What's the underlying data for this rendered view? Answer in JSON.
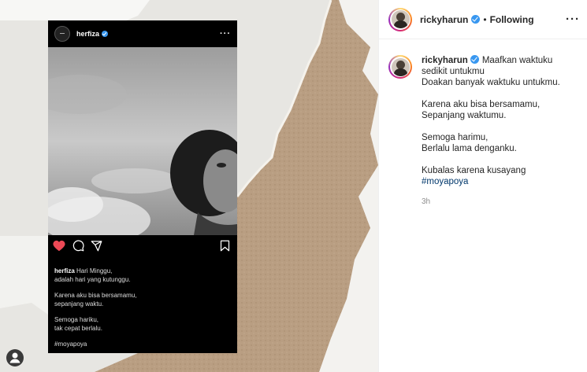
{
  "card": {
    "username": "herfiza",
    "caption_user": "herfiza",
    "caption_lines": [
      "Hari Minggu,\nadalah hari yang kutunggu.",
      "Karena aku bisa bersamamu,\nsepanjang waktu.",
      "Semoga hariku,\ntak cepat berlalu."
    ],
    "hashtag": "#moyapoya",
    "liked": true
  },
  "header": {
    "username": "rickyharun",
    "separator": "•",
    "follow_label": "Following",
    "more_icon": "more-horizontal-icon"
  },
  "comment": {
    "username": "rickyharun",
    "first_line": "Maafkan waktuku",
    "lines": [
      "sedikit untukmu",
      "Doakan banyak waktuku untukmu.",
      "",
      "Karena aku bisa bersamamu,",
      "Sepanjang waktumu.",
      "",
      "Semoga harimu,",
      "Berlalu lama denganku.",
      "",
      "Kubalas karena kusayang"
    ],
    "hashtag": "#moyapoya",
    "time": "3h"
  },
  "colors": {
    "verified": "#3897f0",
    "like_heart": "#ed4956",
    "hashtag": "#00376b",
    "paper_tan": "#b89d80"
  }
}
